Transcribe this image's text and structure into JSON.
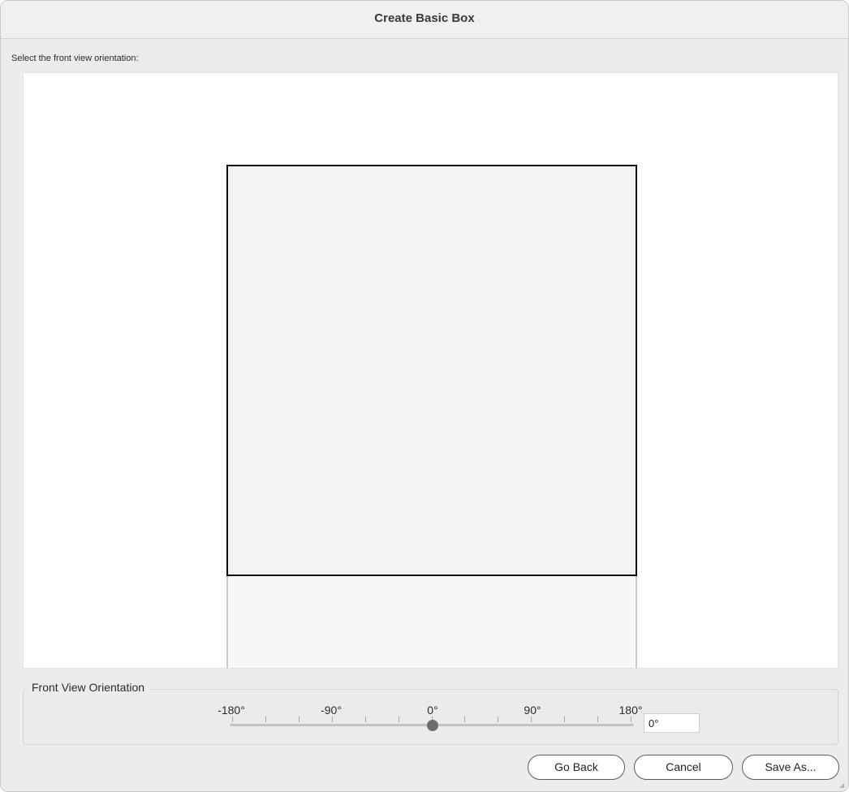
{
  "window": {
    "title": "Create Basic Box"
  },
  "main": {
    "instruction": "Select the front view orientation:"
  },
  "orientation": {
    "group_label": "Front View Orientation",
    "tick_labels": [
      "-180°",
      "-90°",
      "0°",
      "90°",
      "180°"
    ],
    "slider_min": -180,
    "slider_max": 180,
    "slider_value": 0,
    "value_field": "0°"
  },
  "buttons": {
    "go_back": "Go Back",
    "cancel": "Cancel",
    "save_as": "Save As..."
  }
}
